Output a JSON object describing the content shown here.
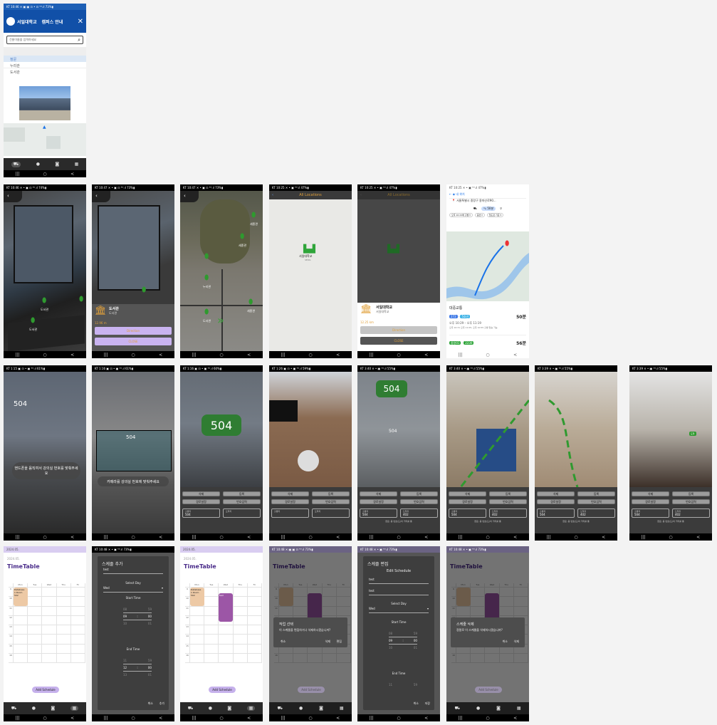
{
  "status": {
    "p1": "KT 10:46 ✕ ▣ ▣ ⊡ •  ⊡ ⁵ᴳ.ıl 73%▮",
    "r2": [
      "KT 10:46 ✕ •   ▣ ⊡ ⁵ᴳ.ıl 74%▮",
      "KT 10:47 ✕ •   ▣ ⊡ ⁵ᴳ.ıl 73%▮",
      "KT 10:47 ✕ •   ▣ ⊡ ⁵ᴳ.ıl 73%▮",
      "KT 10:25 ✕ •   ▣ ⁵ᴳ.ıl 47%▮",
      "KT 10:25 ✕ •   ▣ ⁵ᴳ.ıl 47%▮",
      "KT 10:25 ✕ •   ▣ ⁵ᴳ.ıl 47%▮"
    ],
    "r3": [
      "KT 1:15 ▣ ⊡ •   ▣ ⁵ᴳ.ıl 61%▮",
      "KT 1:16 ▣ ⊡ •   ▣ ⁵ᴳ.ıl 61%▮",
      "KT 1:16 ▣ ⊡ •   ▣ ⁵ᴳ.ıl 60%▮",
      "KT 1:26 ▣ ⊡ •   ▣ ⁵ᴳ.ıl 59%▮",
      "KT 3:40 ✕ •   ▣ ⁵ᴳ.ıl 55%▮",
      "KT 3:40 ✕ •   ▣ ⁵ᴳ.ıl 55%▮",
      "KT 3:39 ✕ •   ▣ ⁵ᴳ.ıl 55%▮",
      "KT 3:39 ✕ •   ▣ ⁵ᴳ.ıl 55%▮"
    ],
    "r4": [
      "2024.05.",
      "KT 10:48 ✕ •   ▣ ⁵ᴳ.ıl 73%▮",
      "2024.05.",
      "KT 10:48 ✕ ▣ ▣ ⊡ ⁵ᴳ.ıl 73%▮",
      "KT 10:48 ✕ •   ▣ ⁵ᴳ.ıl 73%▮",
      "KT 10:48 ✕ •   ▣ ⁵ᴳ.ıl 73%▮"
    ]
  },
  "campus": {
    "univ": "서일대학교",
    "title": "캠퍼스 안내",
    "search_placeholder": "건물이름을 입력하세요",
    "buildings": [
      "정문",
      "누리관",
      "도서관"
    ]
  },
  "nav": [
    "|||",
    "○",
    "<"
  ],
  "bottom_tabs": [
    "map-icon",
    "compass-icon",
    "camera-icon",
    "calendar-icon"
  ],
  "ar_pins": {
    "s1": [
      {
        "name": "도서관",
        "sub": "11.58 m"
      },
      {
        "name": "도서관",
        "sub": ""
      }
    ],
    "s3": [
      {
        "name": "세종관",
        "sub": ""
      },
      {
        "name": "누리관",
        "sub": ""
      },
      {
        "name": "도서관",
        "sub": ""
      },
      {
        "name": "정문",
        "sub": ""
      },
      {
        "name": "세종관",
        "sub": ""
      }
    ]
  },
  "building_card": {
    "name": "도서관",
    "sub": "도서관",
    "dist": "12.96 m",
    "direction": "Direction",
    "close": "CLOSE"
  },
  "all_locations": {
    "title": "All Locations",
    "pin_name": "서일대학교",
    "pin_sub": "SEOIL",
    "card_name": "서일대학교",
    "card_sub": "서일대학교",
    "dist": "12.25 km",
    "direction": "Direction",
    "close": "CLOSE"
  },
  "map_app": {
    "from": "내 위치",
    "to": "서울특별시 중랑구 용마산로90...",
    "mode_label": "50분",
    "depart": "오후 10:22에 출발 ▾",
    "option": "옵션 ▾",
    "rail": "철도로 기준 ▾",
    "section": "대중교통",
    "route1_time": "50분",
    "route1_detail": "오후 10:29 – 오후 11:19",
    "route1_note": "오후 10:31 오후 11:05, 오후 10:55 출발 탑승 가능",
    "route2_time": "56분"
  },
  "ar_room": {
    "room": "504",
    "hint1": "핸드폰을 움직여서 강의실 번호를 맞춰주세요",
    "hint2": "카메라를 강의실 번호에 맞춰주세요",
    "btn_delete": "삭제",
    "btn_register": "등록",
    "btn_path_setting": "경로설정",
    "btn_number_input": "번호입력",
    "start_label": "출발지",
    "start_value": "504",
    "dest_label": "도착지",
    "dest_value": "402",
    "status": "완료, 총 번호(도)의 거리를 통",
    "arrival_tag": "도착"
  },
  "timetable": {
    "date": "2024.05.",
    "title": "TimeTable",
    "days": [
      "Mon",
      "Tue",
      "Wed",
      "Thu",
      "Fri"
    ],
    "days_short": [
      "Mon",
      "Tue",
      "Wed",
      "Thu",
      "Fri"
    ],
    "hours": [
      "9",
      "10",
      "11",
      "12",
      "13",
      "14",
      "15",
      "16"
    ],
    "event1_name": "Database",
    "event1_sub": "1 Room 502",
    "event2_name": "test",
    "event2_sub": "test",
    "add_schedule": "Add Schedule",
    "add_dialog": {
      "title": "스케줄 추가",
      "name_value": "test",
      "select_day": "Select Day",
      "day_value": "Wed",
      "start_time": "Start Time",
      "start_hours": [
        "08",
        "09",
        "10"
      ],
      "start_mins": [
        "59",
        "00",
        "01"
      ],
      "end_time": "End Time",
      "end_hours": [
        "11",
        "12",
        "13"
      ],
      "end_mins": [
        "59",
        "00",
        "01"
      ],
      "cancel": "취소",
      "add": "추가"
    },
    "choose_dialog": {
      "title": "작업 선택",
      "body": "이 스케줄을 편집하거나 삭제하시겠습니까?",
      "cancel": "취소",
      "delete": "삭제",
      "edit": "편집"
    },
    "edit_dialog": {
      "title": "스케줄 편집",
      "subtitle": "Edit Schedule",
      "name_value": "test",
      "room_value": "test",
      "select_day": "Select Day",
      "day_value": "Wed",
      "start_time": "Start Time",
      "start_hours": [
        "08",
        "09",
        "10"
      ],
      "start_mins": [
        "59",
        "00",
        "01"
      ],
      "end_time": "End Time",
      "end_hours": [
        "11",
        "12"
      ],
      "cancel": "취소",
      "save": "저장"
    },
    "delete_dialog": {
      "title": "스케줄 삭제",
      "body": "정말로 이 스케줄을 삭제하시겠습니까?",
      "cancel": "취소",
      "delete": "삭제"
    }
  }
}
